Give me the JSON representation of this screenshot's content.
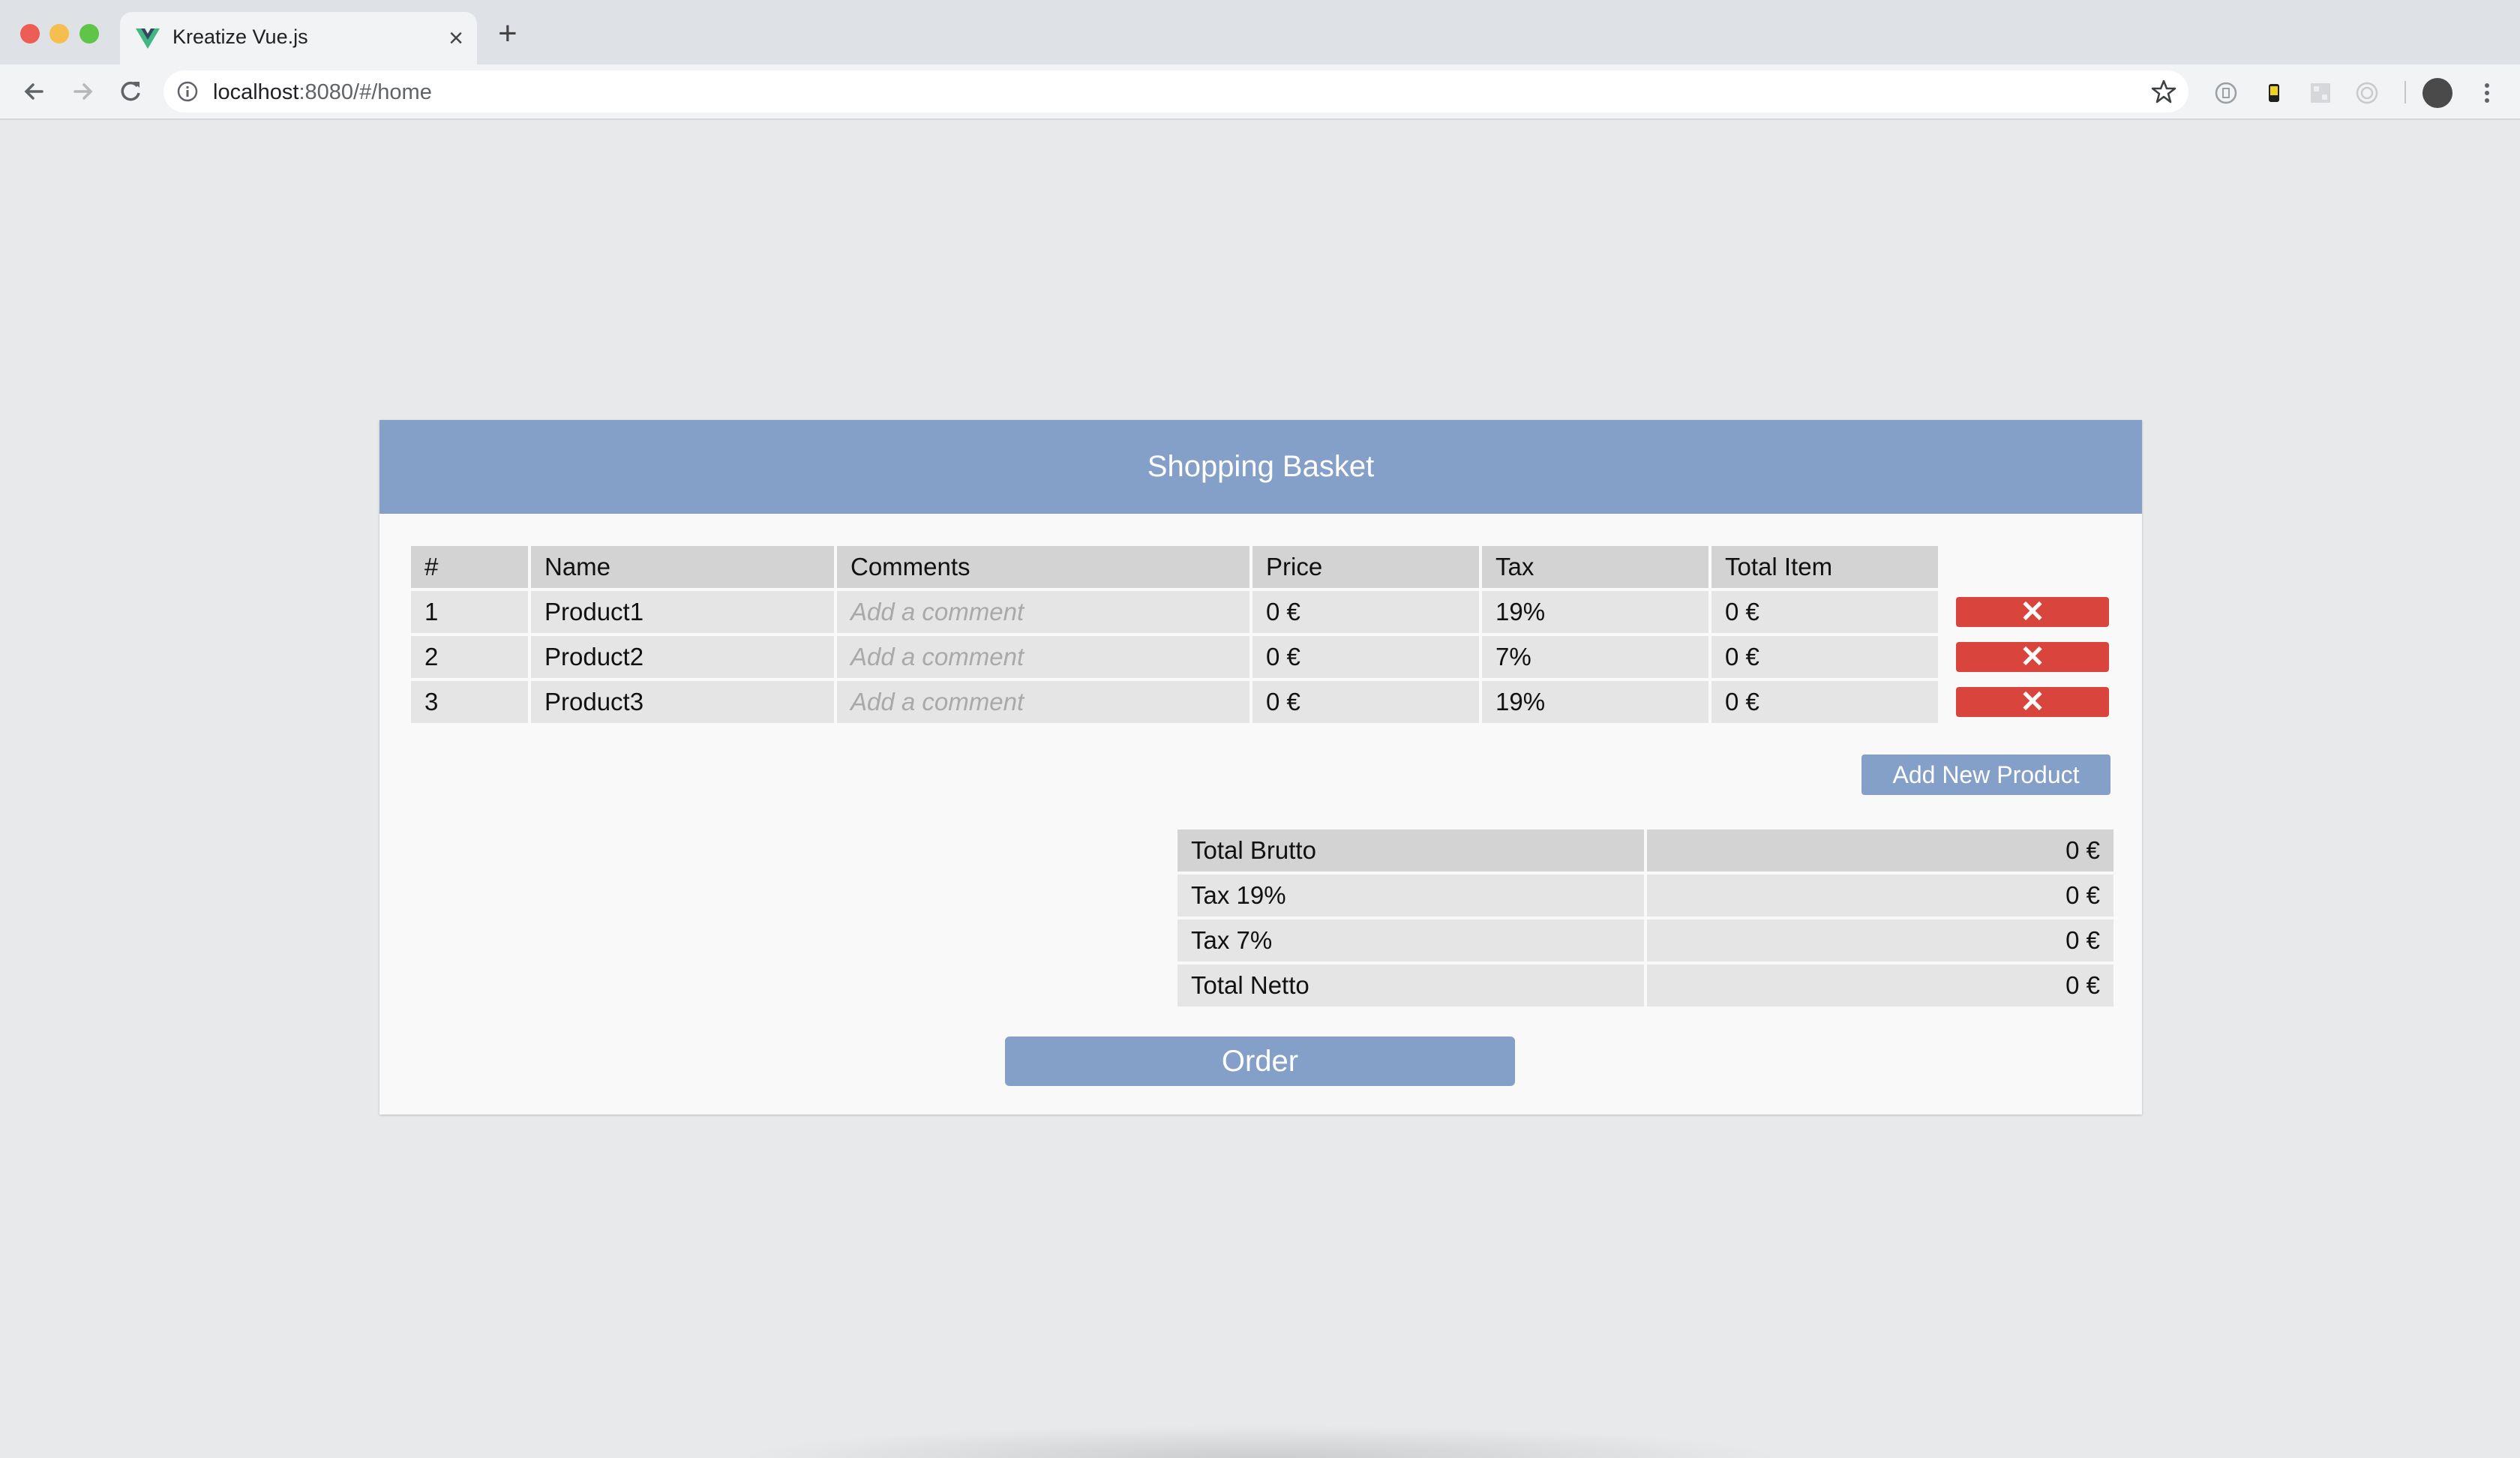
{
  "browser": {
    "tab_title": "Kreatize Vue.js",
    "url_host": "localhost",
    "url_rest": ":8080/#/home"
  },
  "basket": {
    "title": "Shopping Basket",
    "columns": [
      "#",
      "Name",
      "Comments",
      "Price",
      "Tax",
      "Total Item"
    ],
    "rows": [
      {
        "num": "1",
        "name": "Product1",
        "comment_placeholder": "Add a comment",
        "price": "0 €",
        "tax": "19%",
        "total": "0 €"
      },
      {
        "num": "2",
        "name": "Product2",
        "comment_placeholder": "Add a comment",
        "price": "0 €",
        "tax": "7%",
        "total": "0 €"
      },
      {
        "num": "3",
        "name": "Product3",
        "comment_placeholder": "Add a comment",
        "price": "0 €",
        "tax": "19%",
        "total": "0 €"
      }
    ],
    "delete_glyph": "✕",
    "add_label": "Add New Product",
    "totals": [
      {
        "label": "Total Brutto",
        "value": "0 €"
      },
      {
        "label": "Tax 19%",
        "value": "0 €"
      },
      {
        "label": "Tax 7%",
        "value": "0 €"
      },
      {
        "label": "Total Netto",
        "value": "0 €"
      }
    ],
    "order_label": "Order"
  },
  "colors": {
    "accent": "#84a0c8",
    "delete": "#d9443c",
    "header_cell": "#d3d3d3",
    "body_cell": "#e5e5e5"
  }
}
